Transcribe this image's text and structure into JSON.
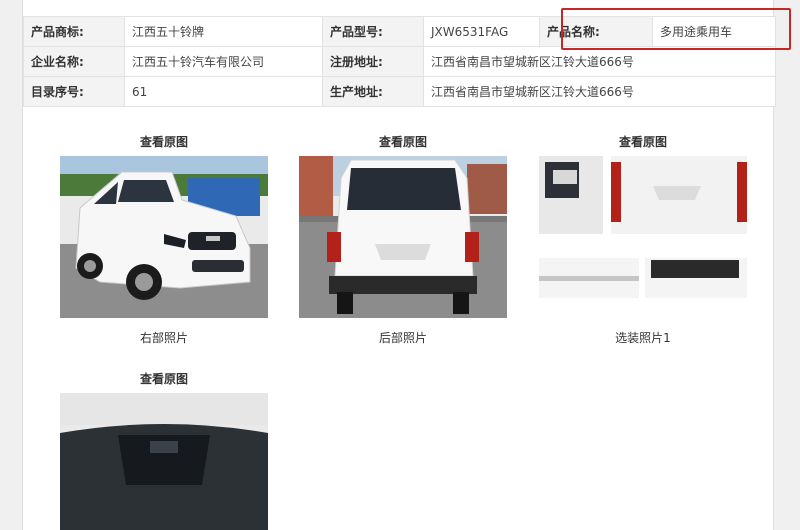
{
  "product_info": {
    "rows": [
      [
        {
          "label": "产品商标:",
          "value": "江西五十铃牌"
        },
        {
          "label": "产品型号:",
          "value": "JXW6531FAG"
        },
        {
          "label": "产品名称:",
          "value": "多用途乘用车"
        }
      ],
      [
        {
          "label": "企业名称:",
          "value": "江西五十铃汽车有限公司"
        },
        {
          "label": "注册地址:",
          "value": "江西省南昌市望城新区江铃大道666号"
        }
      ],
      [
        {
          "label": "目录序号:",
          "value": "61"
        },
        {
          "label": "生产地址:",
          "value": "江西省南昌市望城新区江铃大道666号"
        }
      ]
    ]
  },
  "gallery": [
    {
      "link": "查看原图",
      "caption": "右部照片",
      "image": "front-right-view"
    },
    {
      "link": "查看原图",
      "caption": "后部照片",
      "image": "rear-view"
    },
    {
      "link": "查看原图",
      "caption": "选装照片1",
      "image": "optional-parts-collage"
    },
    {
      "link": "查看原图",
      "caption": "",
      "image": "windshield-detail"
    }
  ],
  "colors": {
    "highlight": "#c62828",
    "label_bg": "#f3f3f3",
    "border": "#e2e2e2"
  }
}
